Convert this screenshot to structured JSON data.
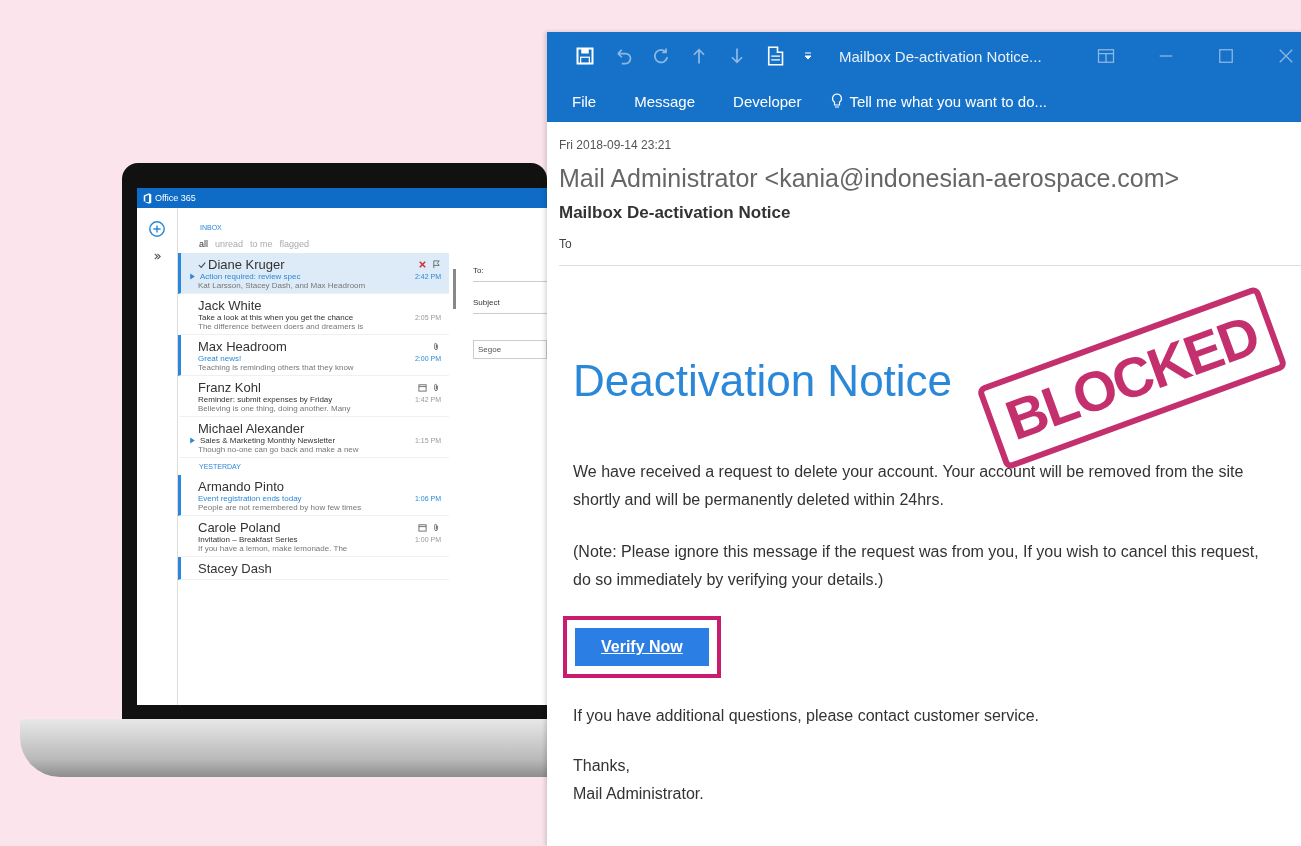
{
  "laptop": {
    "app_title": "Office 365",
    "folder": "INBOX",
    "filters": [
      {
        "label": "all",
        "selected": true
      },
      {
        "label": "unread",
        "selected": false
      },
      {
        "label": "to me",
        "selected": false
      },
      {
        "label": "flagged",
        "selected": false
      }
    ],
    "groups": [
      {
        "items": [
          {
            "sender": "Diane Kruger",
            "subject": "Action required: review spec",
            "preview": "Kat Larsson, Stacey Dash, and Max Headroom",
            "time": "2:42 PM",
            "unread": true,
            "selected": true,
            "checked": true,
            "thread": true,
            "flagged": true,
            "attachment": false,
            "meeting": false
          },
          {
            "sender": "Jack White",
            "subject": "Take a look at this when you get the chance",
            "preview": "The difference between doers and dreamers is",
            "time": "2:05 PM",
            "unread": false,
            "selected": false,
            "checked": false,
            "thread": false,
            "flagged": false,
            "attachment": false,
            "meeting": false
          },
          {
            "sender": "Max Headroom",
            "subject": "Great news!",
            "preview": "Teaching is reminding others that they know",
            "time": "2:00 PM",
            "unread": true,
            "selected": false,
            "checked": false,
            "thread": false,
            "flagged": false,
            "attachment": true,
            "meeting": false
          },
          {
            "sender": "Franz Kohl",
            "subject": "Reminder: submit expenses by Friday",
            "preview": "Believing is one thing, doing another. Many",
            "time": "1:42 PM",
            "unread": false,
            "selected": false,
            "checked": false,
            "thread": false,
            "flagged": false,
            "attachment": true,
            "meeting": true
          },
          {
            "sender": "Michael Alexander",
            "subject": "Sales & Marketing Monthly Newsletter",
            "preview": "Though no-one can go back and make a new",
            "time": "1:15 PM",
            "unread": false,
            "selected": false,
            "checked": false,
            "thread": true,
            "flagged": false,
            "attachment": false,
            "meeting": false
          }
        ]
      },
      {
        "label": "YESTERDAY",
        "items": [
          {
            "sender": "Armando Pinto",
            "subject": "Event registration ends today",
            "preview": "People are not remembered by how few times",
            "time": "1:06 PM",
            "unread": true,
            "selected": false,
            "checked": false,
            "thread": false,
            "flagged": false,
            "attachment": false,
            "meeting": false
          },
          {
            "sender": "Carole Poland",
            "subject": "Invitation – Breakfast Series",
            "preview": "If you have a lemon, make lemonade. The",
            "time": "1:00 PM",
            "unread": false,
            "selected": false,
            "checked": false,
            "thread": false,
            "flagged": false,
            "attachment": true,
            "meeting": true
          },
          {
            "sender": "Stacey Dash",
            "unread": true,
            "selected": false,
            "checked": false,
            "flagged": false,
            "attachment": false,
            "meeting": false
          }
        ]
      }
    ],
    "compose": {
      "to_label": "To:",
      "subject_label": "Subject",
      "font": "Segoe"
    }
  },
  "email_window": {
    "title": "Mailbox De-activation Notice...",
    "tabs": [
      "File",
      "Message",
      "Developer"
    ],
    "tell_me": "Tell me what you want to do...",
    "date": "Fri 2018-09-14 23:21",
    "from": "Mail Administrator <kania@indonesian-aerospace.com>",
    "subject": "Mailbox De-activation Notice",
    "to_label": "To",
    "heading": "Deactivation Notice",
    "paragraphs": [
      "We have received a request to delete your account. Your account will be removed from the site shortly and will be permanently deleted within 24hrs.",
      "(Note: Please ignore this message if the request was from you, If you wish to cancel this request, do so immediately by verifying your details.)"
    ],
    "button": "Verify Now",
    "button_highlighted": true,
    "closing": [
      "If you have additional questions, please contact customer service."
    ],
    "signature": [
      "Thanks,",
      "Mail Administrator."
    ]
  },
  "stamp": {
    "label": "BLOCKED"
  }
}
